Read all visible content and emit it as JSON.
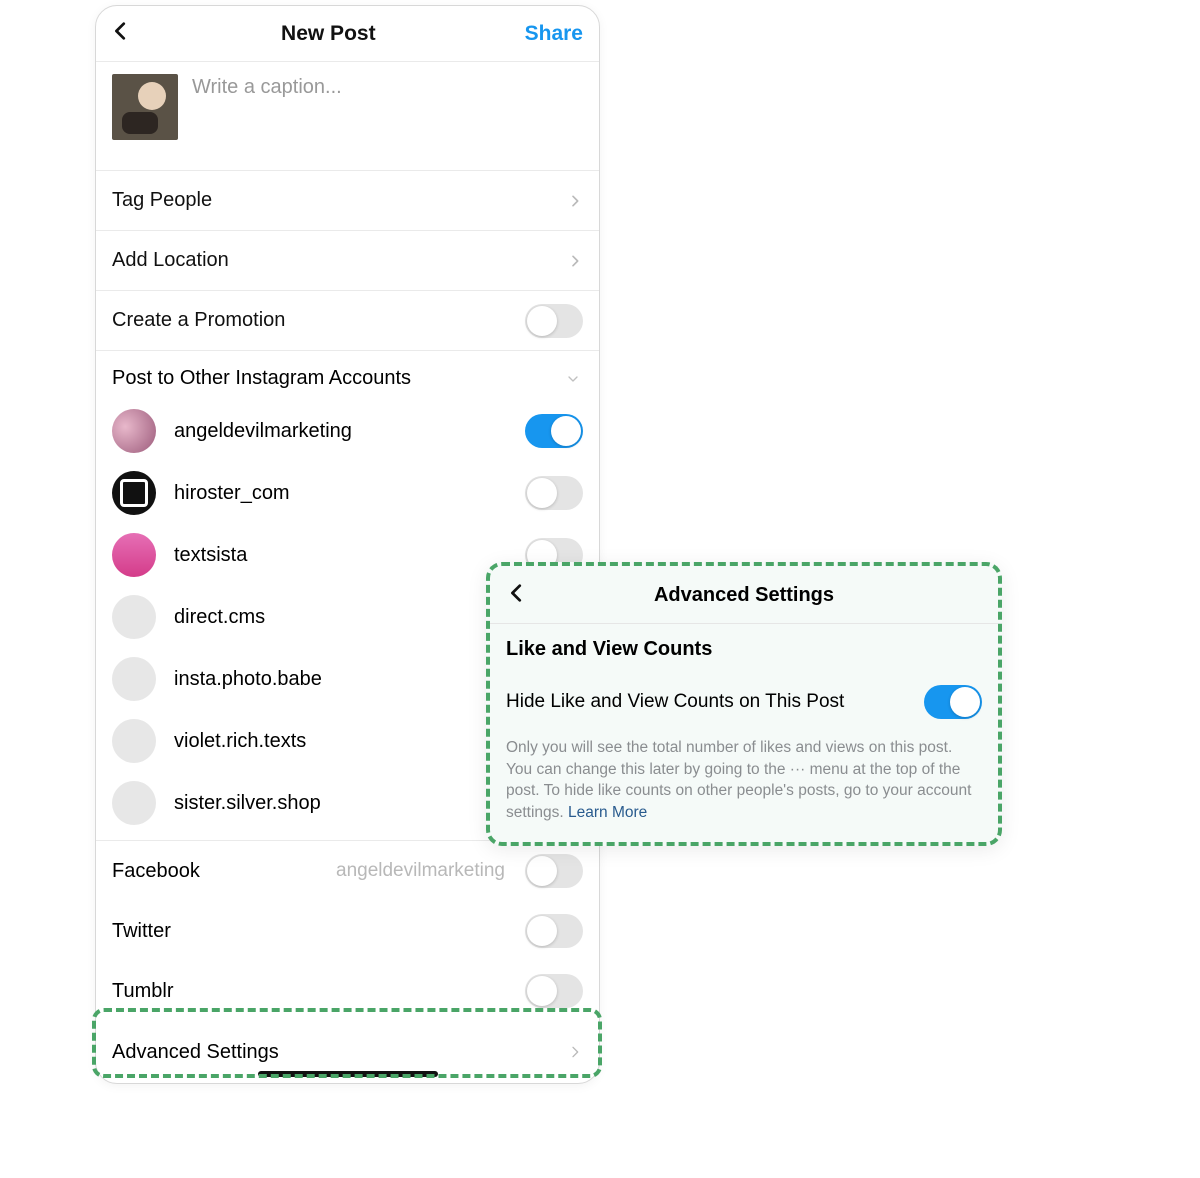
{
  "header": {
    "title": "New Post",
    "share": "Share"
  },
  "caption": {
    "placeholder": "Write a caption..."
  },
  "rows": {
    "tag_people": "Tag People",
    "add_location": "Add Location",
    "create_promotion": "Create a Promotion"
  },
  "other_accounts": {
    "heading": "Post to Other Instagram Accounts",
    "items": [
      {
        "name": "angeldevilmarketing",
        "on": true,
        "avatar": "colored1"
      },
      {
        "name": "hiroster_com",
        "on": false,
        "avatar": "colored2"
      },
      {
        "name": "textsista",
        "on": false,
        "avatar": "colored3"
      },
      {
        "name": "direct.cms",
        "on": false,
        "avatar": ""
      },
      {
        "name": "insta.photo.babe",
        "on": false,
        "avatar": ""
      },
      {
        "name": "violet.rich.texts",
        "on": false,
        "avatar": ""
      },
      {
        "name": "sister.silver.shop",
        "on": false,
        "avatar": ""
      }
    ]
  },
  "external": [
    {
      "name": "Facebook",
      "sub": "angeldevilmarketing",
      "on": false
    },
    {
      "name": "Twitter",
      "sub": "",
      "on": false
    },
    {
      "name": "Tumblr",
      "sub": "",
      "on": false
    }
  ],
  "advanced_label": "Advanced Settings",
  "panel": {
    "title": "Advanced Settings",
    "section": "Like and View Counts",
    "row": "Hide Like and View Counts on This Post",
    "desc": "Only you will see the total number of likes and views on this post. You can change this later by going to the ··· menu at the top of the post. To hide like counts on other people's posts, go to your account settings. ",
    "learn_more": "Learn More"
  }
}
